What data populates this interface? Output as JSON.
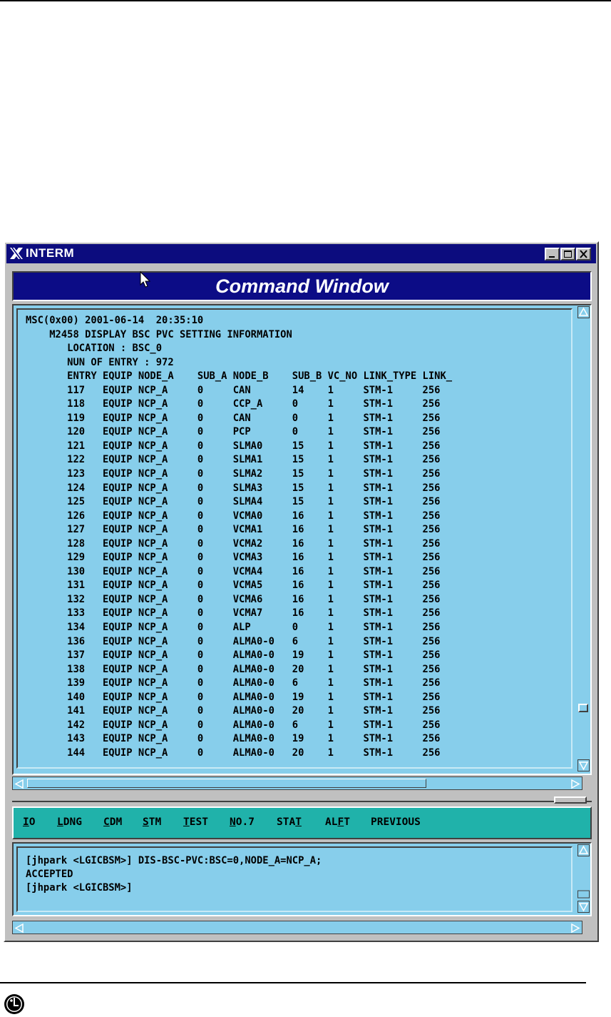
{
  "window": {
    "title": "INTERM",
    "header_title": "Command Window"
  },
  "output": {
    "header_lines": [
      "MSC(0x00) 2001-06-14  20:35:10",
      "    M2458 DISPLAY BSC PVC SETTING INFORMATION",
      "       LOCATION : BSC_0",
      "       NUN OF ENTRY : 972"
    ],
    "columns": [
      "ENTRY",
      "EQUIP",
      "NODE_A",
      "SUB_A",
      "NODE_B",
      "SUB_B",
      "VC_NO",
      "LINK_TYPE",
      "LINK_"
    ],
    "rows": [
      [
        "117",
        "EQUIP",
        "NCP_A",
        "0",
        "CAN",
        "14",
        "1",
        "STM-1",
        "256"
      ],
      [
        "118",
        "EQUIP",
        "NCP_A",
        "0",
        "CCP_A",
        "0",
        "1",
        "STM-1",
        "256"
      ],
      [
        "119",
        "EQUIP",
        "NCP_A",
        "0",
        "CAN",
        "0",
        "1",
        "STM-1",
        "256"
      ],
      [
        "120",
        "EQUIP",
        "NCP_A",
        "0",
        "PCP",
        "0",
        "1",
        "STM-1",
        "256"
      ],
      [
        "121",
        "EQUIP",
        "NCP_A",
        "0",
        "SLMA0",
        "15",
        "1",
        "STM-1",
        "256"
      ],
      [
        "122",
        "EQUIP",
        "NCP_A",
        "0",
        "SLMA1",
        "15",
        "1",
        "STM-1",
        "256"
      ],
      [
        "123",
        "EQUIP",
        "NCP_A",
        "0",
        "SLMA2",
        "15",
        "1",
        "STM-1",
        "256"
      ],
      [
        "124",
        "EQUIP",
        "NCP_A",
        "0",
        "SLMA3",
        "15",
        "1",
        "STM-1",
        "256"
      ],
      [
        "125",
        "EQUIP",
        "NCP_A",
        "0",
        "SLMA4",
        "15",
        "1",
        "STM-1",
        "256"
      ],
      [
        "126",
        "EQUIP",
        "NCP_A",
        "0",
        "VCMA0",
        "16",
        "1",
        "STM-1",
        "256"
      ],
      [
        "127",
        "EQUIP",
        "NCP_A",
        "0",
        "VCMA1",
        "16",
        "1",
        "STM-1",
        "256"
      ],
      [
        "128",
        "EQUIP",
        "NCP_A",
        "0",
        "VCMA2",
        "16",
        "1",
        "STM-1",
        "256"
      ],
      [
        "129",
        "EQUIP",
        "NCP_A",
        "0",
        "VCMA3",
        "16",
        "1",
        "STM-1",
        "256"
      ],
      [
        "130",
        "EQUIP",
        "NCP_A",
        "0",
        "VCMA4",
        "16",
        "1",
        "STM-1",
        "256"
      ],
      [
        "131",
        "EQUIP",
        "NCP_A",
        "0",
        "VCMA5",
        "16",
        "1",
        "STM-1",
        "256"
      ],
      [
        "132",
        "EQUIP",
        "NCP_A",
        "0",
        "VCMA6",
        "16",
        "1",
        "STM-1",
        "256"
      ],
      [
        "133",
        "EQUIP",
        "NCP_A",
        "0",
        "VCMA7",
        "16",
        "1",
        "STM-1",
        "256"
      ],
      [
        "134",
        "EQUIP",
        "NCP_A",
        "0",
        "ALP",
        "0",
        "1",
        "STM-1",
        "256"
      ],
      [
        "136",
        "EQUIP",
        "NCP_A",
        "0",
        "ALMA0-0",
        "6",
        "1",
        "STM-1",
        "256"
      ],
      [
        "137",
        "EQUIP",
        "NCP_A",
        "0",
        "ALMA0-0",
        "19",
        "1",
        "STM-1",
        "256"
      ],
      [
        "138",
        "EQUIP",
        "NCP_A",
        "0",
        "ALMA0-0",
        "20",
        "1",
        "STM-1",
        "256"
      ],
      [
        "139",
        "EQUIP",
        "NCP_A",
        "0",
        "ALMA0-0",
        "6",
        "1",
        "STM-1",
        "256"
      ],
      [
        "140",
        "EQUIP",
        "NCP_A",
        "0",
        "ALMA0-0",
        "19",
        "1",
        "STM-1",
        "256"
      ],
      [
        "141",
        "EQUIP",
        "NCP_A",
        "0",
        "ALMA0-0",
        "20",
        "1",
        "STM-1",
        "256"
      ],
      [
        "142",
        "EQUIP",
        "NCP_A",
        "0",
        "ALMA0-0",
        "6",
        "1",
        "STM-1",
        "256"
      ],
      [
        "143",
        "EQUIP",
        "NCP_A",
        "0",
        "ALMA0-0",
        "19",
        "1",
        "STM-1",
        "256"
      ],
      [
        "144",
        "EQUIP",
        "NCP_A",
        "0",
        "ALMA0-0",
        "20",
        "1",
        "STM-1",
        "256"
      ]
    ]
  },
  "menu": {
    "items": [
      {
        "u": "I",
        "rest": "O"
      },
      {
        "u": "L",
        "rest": "DNG"
      },
      {
        "u": "C",
        "rest": "DM"
      },
      {
        "u": "S",
        "rest": "TM"
      },
      {
        "u": "T",
        "rest": "EST"
      },
      {
        "u": "N",
        "rest": "O.7"
      },
      {
        "pre": "STA",
        "u": "T",
        "rest": ""
      },
      {
        "pre": "AL",
        "u": "F",
        "rest": "T"
      },
      {
        "pre": "",
        "u": "",
        "rest": "PREVIOUS"
      }
    ]
  },
  "input": {
    "lines": [
      "[jhpark <LGICBSM>] DIS-BSC-PVC:BSC=0,NODE_A=NCP_A;",
      "ACCEPTED",
      "[jhpark <LGICBSM>]"
    ]
  },
  "colors": {
    "title_bar": "#0c0c7e",
    "panel_bg": "#87ceeb",
    "menu_bg": "#20b2aa"
  },
  "icons": {
    "window_icon": "x-logo-icon",
    "pointer": "mouse-pointer-icon",
    "footer_logo": "lg-logo-icon"
  }
}
